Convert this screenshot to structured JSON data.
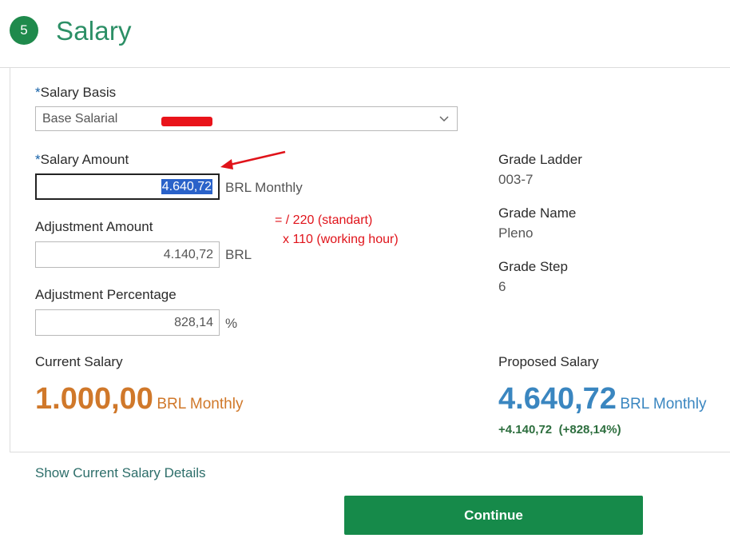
{
  "section": {
    "step_number": "5",
    "title": "Salary"
  },
  "salary_basis": {
    "required_mark": "*",
    "label": "Salary Basis",
    "value": "Base Salarial",
    "icon": "chevron-down-icon"
  },
  "salary_amount": {
    "required_mark": "*",
    "label": "Salary Amount",
    "value": "4.640,72",
    "unit": "BRL Monthly"
  },
  "adjustment_amount": {
    "label": "Adjustment Amount",
    "value": "4.140,72",
    "unit": "BRL"
  },
  "adjustment_percentage": {
    "label": "Adjustment Percentage",
    "value": "828,14",
    "unit": "%"
  },
  "grade": {
    "ladder_label": "Grade Ladder",
    "ladder_value": "003-7",
    "name_label": "Grade Name",
    "name_value": "Pleno",
    "step_label": "Grade Step",
    "step_value": "6"
  },
  "current_salary": {
    "label": "Current Salary",
    "value": "1.000,00",
    "unit": "BRL Monthly"
  },
  "proposed_salary": {
    "label": "Proposed Salary",
    "value": "4.640,72",
    "unit": "BRL Monthly",
    "delta_amount": "+4.140,72",
    "delta_percent": "(+828,14%)"
  },
  "annotation": {
    "line1": "= / 220 (standart)",
    "line2": "x 110 (working hour)",
    "color": "#e0131a"
  },
  "details_link": "Show Current Salary Details",
  "continue_button": "Continue",
  "colors": {
    "brand_green": "#168a4a",
    "current_orange": "#d0782a",
    "proposed_blue": "#3a86c0"
  }
}
